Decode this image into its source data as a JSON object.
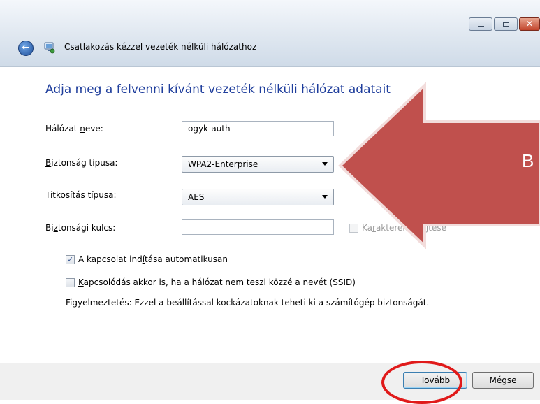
{
  "window": {
    "title": "Csatlakozás kézzel vezeték nélküli hálózathoz",
    "icons": {
      "back": "back-arrow-icon",
      "network": "wireless-network-icon",
      "minimize": "minimize-icon",
      "maximize": "maximize-icon",
      "close": "close-icon"
    },
    "close_glyph": "✕",
    "back_glyph": "←"
  },
  "heading": "Adja meg a felvenni kívánt vezeték nélküli hálózat adatait",
  "form": {
    "network_name": {
      "label_pre": "Hálózat ",
      "label_ul": "n",
      "label_post": "eve:",
      "value": "ogyk-auth"
    },
    "security_type": {
      "label_ul": "B",
      "label_post": "iztonság típusa:",
      "value": "WPA2-Enterprise"
    },
    "encryption_type": {
      "label_ul": "T",
      "label_post": "itkosítás típusa:",
      "value": "AES"
    },
    "security_key": {
      "label_pre": "Bi",
      "label_ul": "z",
      "label_post": "tonsági kulcs:",
      "value": ""
    },
    "hide_chars": {
      "label_pre": "Ka",
      "label_ul": "r",
      "label_post": "akterek elrejtése",
      "checked": false,
      "enabled": false
    }
  },
  "options": {
    "auto_start": {
      "label_pre": "A kapcsolat ind",
      "label_ul": "í",
      "label_post": "tása automatikusan",
      "checked": true
    },
    "connect_hidden": {
      "label_ul": "K",
      "label_post": "apcsolódás akkor is, ha a hálózat nem teszi közzé a nevét (SSID)",
      "checked": false
    }
  },
  "warning": "Figyelmeztetés: Ezzel a beállítással kockázatoknak teheti ki a számítógép biztonságát.",
  "buttons": {
    "next": {
      "label_ul": "T",
      "label_post": "ovább"
    },
    "cancel": {
      "label": "Mégse"
    }
  },
  "annotation": {
    "arrow_text": "B",
    "arrow_color": "#c0504d",
    "arrow_border": "#f2dcdb",
    "circle_color": "#e01a1a"
  }
}
